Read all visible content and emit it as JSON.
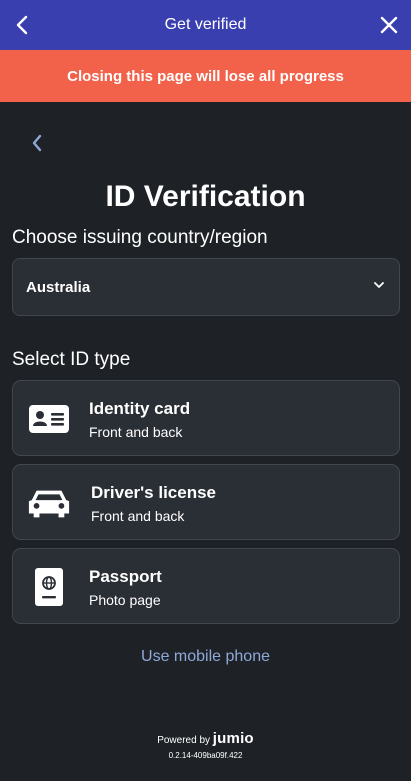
{
  "header": {
    "title": "Get verified",
    "back_icon": "chevron-left-icon",
    "close_icon": "close-icon",
    "color": "#3a3fb0"
  },
  "warning": {
    "text": "Closing this page will lose all progress",
    "color": "#f2624a"
  },
  "main": {
    "heading": "ID Verification",
    "country_label": "Choose issuing country/region",
    "country_selected": "Australia",
    "idtype_label": "Select ID type",
    "id_types": [
      {
        "title": "Identity card",
        "subtitle": "Front and back",
        "icon": "id-card-icon"
      },
      {
        "title": "Driver's license",
        "subtitle": "Front and back",
        "icon": "car-icon"
      },
      {
        "title": "Passport",
        "subtitle": "Photo page",
        "icon": "passport-icon"
      }
    ],
    "mobile_link": "Use mobile phone"
  },
  "footer": {
    "powered_by": "Powered by",
    "brand": "jumio",
    "version": "0.2.14-409ba09f.422"
  },
  "colors": {
    "background": "#1e2227",
    "card": "#2a2e35",
    "link": "#8fa8d8"
  }
}
